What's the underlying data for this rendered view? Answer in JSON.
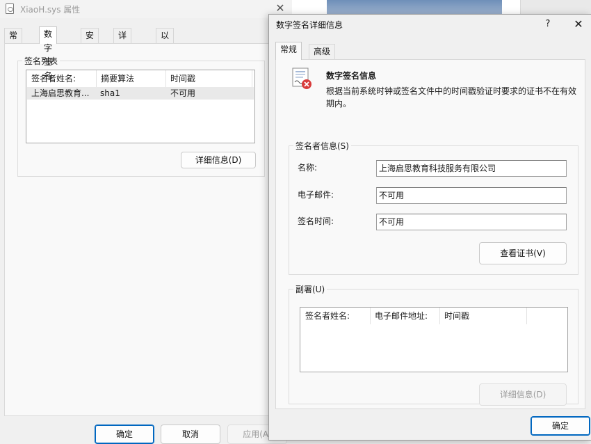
{
  "background": {
    "colors": {
      "sky": "#7f9cc2"
    }
  },
  "properties_window": {
    "title": "XiaoH.sys 属性",
    "tabs": [
      "常规",
      "数字签名",
      "安全",
      "详细信息",
      "以前的版本"
    ],
    "active_tab": "数字签名",
    "signature_group_label": "签名列表",
    "columns": [
      "签名者姓名:",
      "摘要算法",
      "时间戳"
    ],
    "rows": [
      {
        "signer": "上海启思教育...",
        "algorithm": "sha1",
        "timestamp": "不可用"
      }
    ],
    "details_button": "详细信息(D)",
    "ok_button": "确定",
    "cancel_button": "取消",
    "apply_button": "应用(A)"
  },
  "dialog": {
    "title": "数字签名详细信息",
    "help_label": "?",
    "close_label": "✕",
    "tabs": [
      "常规",
      "高级"
    ],
    "info_title": "数字签名信息",
    "info_desc": "根据当前系统时钟或签名文件中的时间戳验证时要求的证书不在有效期内。",
    "signer_group_label": "签名者信息(S)",
    "fields": [
      {
        "label": "名称:",
        "value": "上海启思教育科技服务有限公司"
      },
      {
        "label": "电子邮件:",
        "value": "不可用"
      },
      {
        "label": "签名时间:",
        "value": "不可用"
      }
    ],
    "view_cert_button": "查看证书(V)",
    "countersign_group_label": "副署(U)",
    "countersign_columns": [
      "签名者姓名:",
      "电子邮件地址:",
      "时间戳"
    ],
    "countersign_details_button": "详细信息(D)",
    "ok_button": "确定"
  },
  "colors": {
    "accent": "#0067c0",
    "error": "#d83b3b"
  },
  "icons": [
    "file-icon",
    "close-icon",
    "help-icon",
    "certificate-error-icon"
  ]
}
